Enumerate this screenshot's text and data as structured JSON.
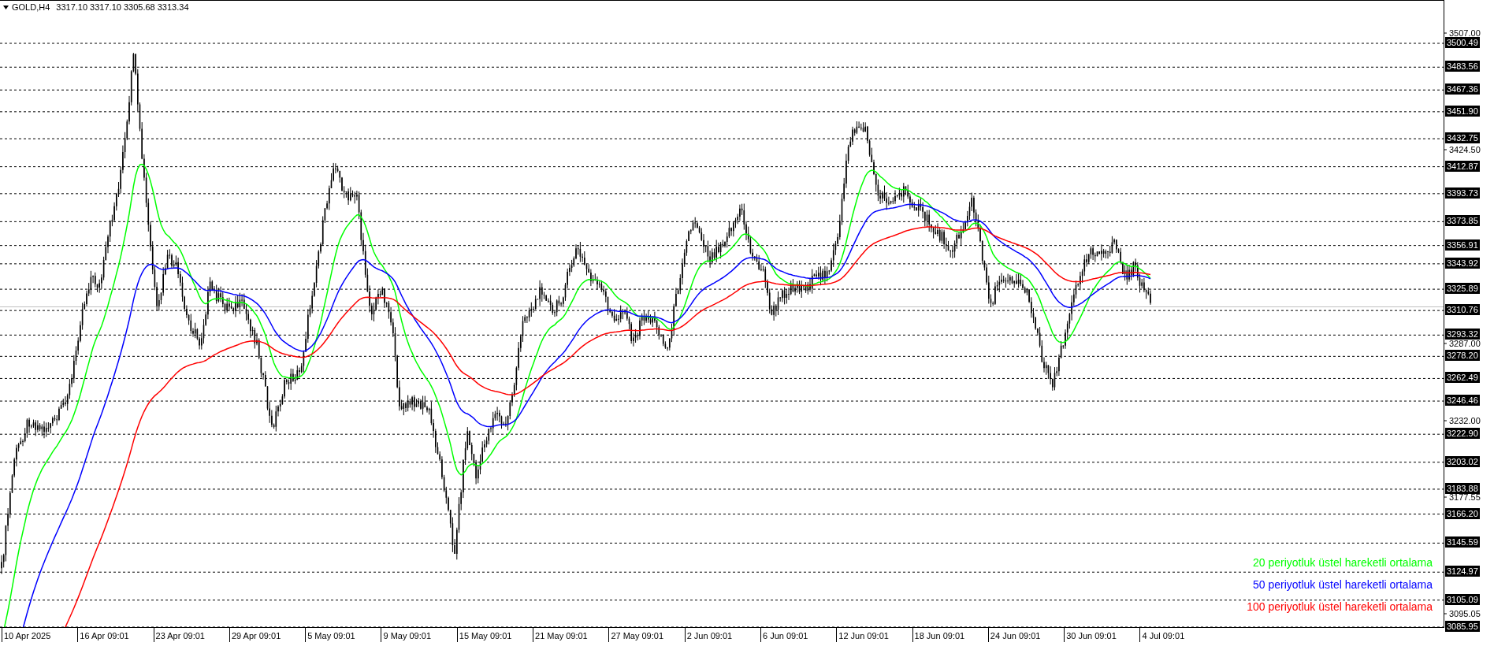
{
  "header": {
    "symbol": "GOLD,H4",
    "ohlc": "3317.10 3317.10 3305.68 3313.34"
  },
  "price_axis": {
    "ticks": [
      "3507.00",
      "3424.50",
      "3287.00",
      "3232.00",
      "3177.55",
      "3095.05"
    ],
    "levels": [
      "3500.49",
      "3483.56",
      "3467.36",
      "3451.90",
      "3432.75",
      "3412.87",
      "3393.73",
      "3373.85",
      "3356.91",
      "3343.92",
      "3325.89",
      "3310.76",
      "3293.32",
      "3278.20",
      "3262.49",
      "3246.46",
      "3222.90",
      "3203.02",
      "3183.88",
      "3166.20",
      "3145.59",
      "3124.97",
      "3105.09",
      "3085.95"
    ]
  },
  "time_axis": [
    "10 Apr 2025",
    "16 Apr 09:01",
    "23 Apr 09:01",
    "29 Apr 09:01",
    "5 May 09:01",
    "9 May 09:01",
    "15 May 09:01",
    "21 May 09:01",
    "27 May 09:01",
    "2 Jun 09:01",
    "6 Jun 09:01",
    "12 Jun 09:01",
    "18 Jun 09:01",
    "24 Jun 09:01",
    "30 Jun 09:01",
    "4 Jul 09:01"
  ],
  "legend": [
    {
      "text": "20 periyotluk üstel hareketli ortalama",
      "color": "#00ff00"
    },
    {
      "text": "50 periyotluk üstel hareketli ortalama",
      "color": "#0000ff"
    },
    {
      "text": "100 periyotluk üstel hareketli ortalama",
      "color": "#ff0000"
    }
  ]
}
